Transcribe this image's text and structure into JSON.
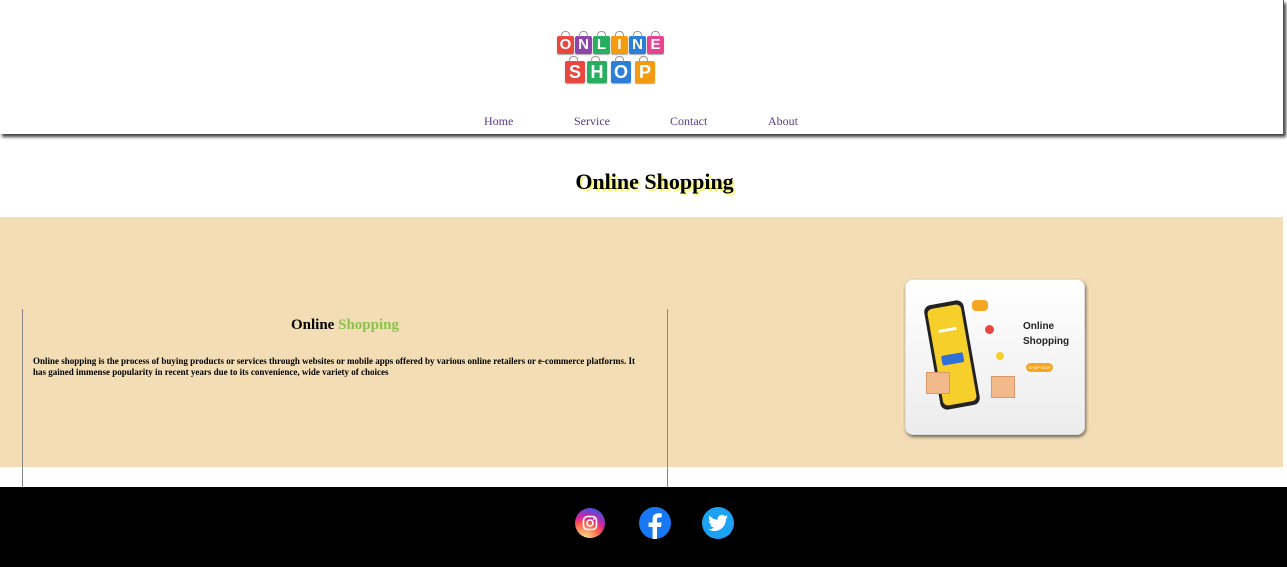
{
  "header": {
    "logo": {
      "alt": "ONLINE SHOP",
      "row1": [
        "O",
        "N",
        "L",
        "I",
        "N",
        "E"
      ],
      "row2": [
        "S",
        "H",
        "O",
        "P"
      ],
      "colors": [
        "#e8483f",
        "#8e44ad",
        "#27ae60",
        "#f39c12",
        "#2d7fd6",
        "#e84393"
      ]
    },
    "nav": [
      "Home",
      "Service",
      "Contact",
      "About"
    ]
  },
  "title": {
    "part1": "Online",
    "part2": "Shopping"
  },
  "card": {
    "title_part1": "Online",
    "title_part2": "Shopping",
    "text": "Online shopping is the process of buying products or services through websites or mobile apps offered by various online retailers or e-commerce platforms. It has gained immense popularity in recent years due to its convenience, wide variety of choices"
  },
  "promo": {
    "line1": "Online",
    "line2": "Shopping",
    "button": "SHOP NOW"
  },
  "footer": {
    "icons": [
      "instagram-icon",
      "facebook-icon",
      "twitter-icon"
    ]
  },
  "colors": {
    "band": "#f3ddb5",
    "nav_link": "#5a3a8c",
    "accent": "#8bc34a",
    "title_shadow": "#f7f77a",
    "footer": "#000000"
  }
}
